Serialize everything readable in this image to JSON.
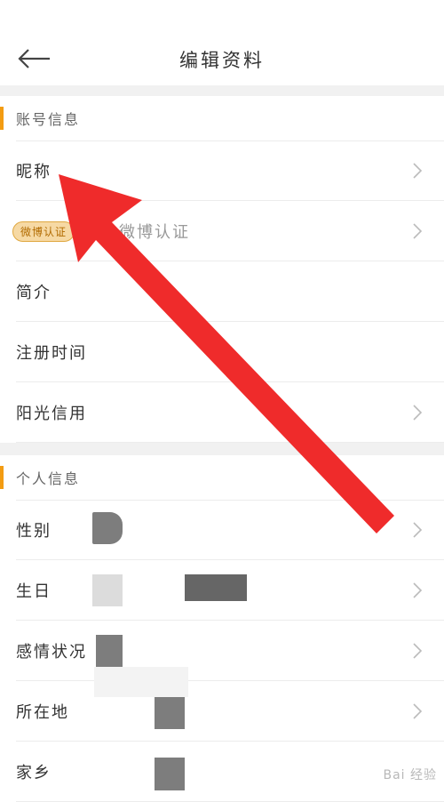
{
  "header": {
    "title": "编辑资料",
    "back_icon": "arrow-left-icon"
  },
  "account_section": {
    "title": "账号信息",
    "items": [
      {
        "label": "昵称",
        "value": ""
      },
      {
        "label": "加入微博认证",
        "badge": "微博认证"
      },
      {
        "label": "简介",
        "value": ""
      },
      {
        "label": "注册时间",
        "value": ""
      },
      {
        "label": "阳光信用",
        "value": ""
      }
    ]
  },
  "personal_section": {
    "title": "个人信息",
    "items": [
      {
        "label": "性别"
      },
      {
        "label": "生日"
      },
      {
        "label": "感情状况"
      },
      {
        "label": "所在地"
      },
      {
        "label": "家乡"
      }
    ]
  },
  "colors": {
    "accent": "#f39c12",
    "arrow": "#ef2b2b",
    "divider": "#ececec"
  },
  "watermark": "Bai 经验"
}
